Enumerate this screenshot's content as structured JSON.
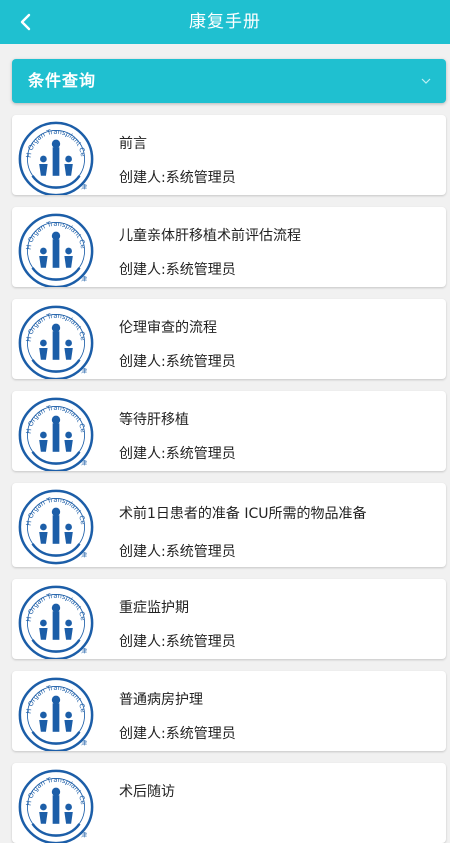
{
  "header": {
    "title": "康复手册",
    "back_icon": "back-arrow-icon"
  },
  "filter": {
    "label": "条件查询",
    "icon": "chevron-down-icon"
  },
  "logo": {
    "text": "TFCH Organ Transplant Center",
    "mark": "津"
  },
  "items": [
    {
      "title": "前言",
      "creator": "创建人:系统管理员"
    },
    {
      "title": "儿童亲体肝移植术前评估流程",
      "creator": "创建人:系统管理员"
    },
    {
      "title": "伦理审查的流程",
      "creator": "创建人:系统管理员"
    },
    {
      "title": "等待肝移植",
      "creator": "创建人:系统管理员"
    },
    {
      "title": "术前1日患者的准备 ICU所需的物品准备",
      "creator": "创建人:系统管理员"
    },
    {
      "title": "重症监护期",
      "creator": "创建人:系统管理员"
    },
    {
      "title": "普通病房护理",
      "creator": "创建人:系统管理员"
    },
    {
      "title": "术后随访",
      "creator": ""
    }
  ],
  "colors": {
    "accent": "#1fc0d0",
    "logo_blue": "#1c5ea8"
  }
}
